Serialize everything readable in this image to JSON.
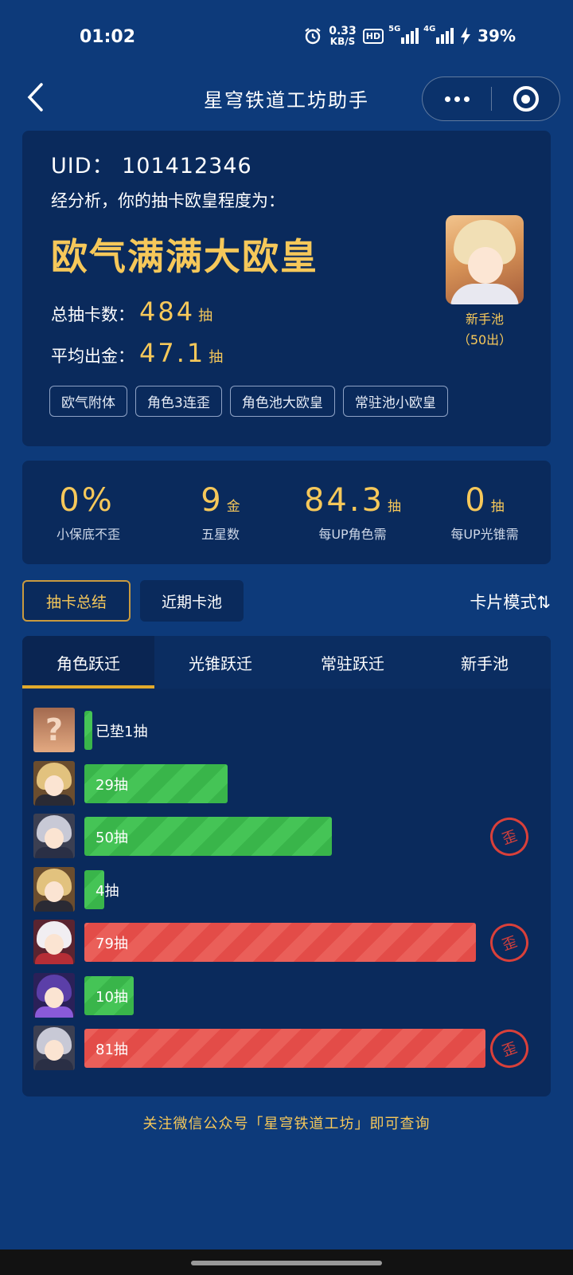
{
  "status_bar": {
    "time": "01:02",
    "net_speed_value": "0.33",
    "net_speed_unit": "KB/S",
    "hd_badge": "HD",
    "signal_5g": "5G",
    "signal_4g": "4G",
    "battery": "39%"
  },
  "nav": {
    "title": "星穹铁道工坊助手"
  },
  "profile": {
    "uid": "UID：  101412346",
    "analysis": "经分析，你的抽卡欧皇程度为：",
    "rank": "欧气满满大欧皇",
    "total_label": "总抽卡数：",
    "total_value": "484",
    "total_unit": "抽",
    "avg_label": "平均出金：",
    "avg_value": "47.1",
    "avg_unit": "抽",
    "pool_name": "新手池",
    "pool_note": "（50出）",
    "tags": [
      "欧气附体",
      "角色3连歪",
      "角色池大欧皇",
      "常驻池小欧皇"
    ]
  },
  "summary": [
    {
      "value": "0%",
      "unit": "",
      "label": "小保底不歪"
    },
    {
      "value": "9",
      "unit": "金",
      "label": "五星数"
    },
    {
      "value": "84.3",
      "unit": "抽",
      "label": "每UP角色需"
    },
    {
      "value": "0",
      "unit": "抽",
      "label": "每UP光锥需"
    }
  ],
  "mode": {
    "summary_btn": "抽卡总结",
    "recent_btn": "近期卡池",
    "switch_label": "卡片模式⇅"
  },
  "tabs": [
    "角色跃迁",
    "光锥跃迁",
    "常驻跃迁",
    "新手池"
  ],
  "pulls": [
    {
      "label": "已垫1抽",
      "pulls": 1,
      "color": "green",
      "off_banner": false,
      "avatar": "question-mark"
    },
    {
      "label": "29抽",
      "pulls": 29,
      "color": "green",
      "off_banner": false,
      "avatar": "blonde"
    },
    {
      "label": "50抽",
      "pulls": 50,
      "color": "green",
      "off_banner": true,
      "avatar": "silver"
    },
    {
      "label": "4抽",
      "pulls": 4,
      "color": "green",
      "off_banner": false,
      "avatar": "blonde"
    },
    {
      "label": "79抽",
      "pulls": 79,
      "color": "red",
      "off_banner": true,
      "avatar": "white"
    },
    {
      "label": "10抽",
      "pulls": 10,
      "color": "green",
      "off_banner": false,
      "avatar": "purple"
    },
    {
      "label": "81抽",
      "pulls": 81,
      "color": "red",
      "off_banner": true,
      "avatar": "silver"
    }
  ],
  "off_banner_mark": "歪",
  "footer": "关注微信公众号「星穹铁道工坊」即可查询",
  "colors": {
    "background": "#0d3a7a",
    "card": "#0a2a5c",
    "gold": "#f6c85a",
    "green_bar": "#39b54a",
    "red_bar": "#e34c48",
    "tab_underline": "#e2aa2c"
  }
}
